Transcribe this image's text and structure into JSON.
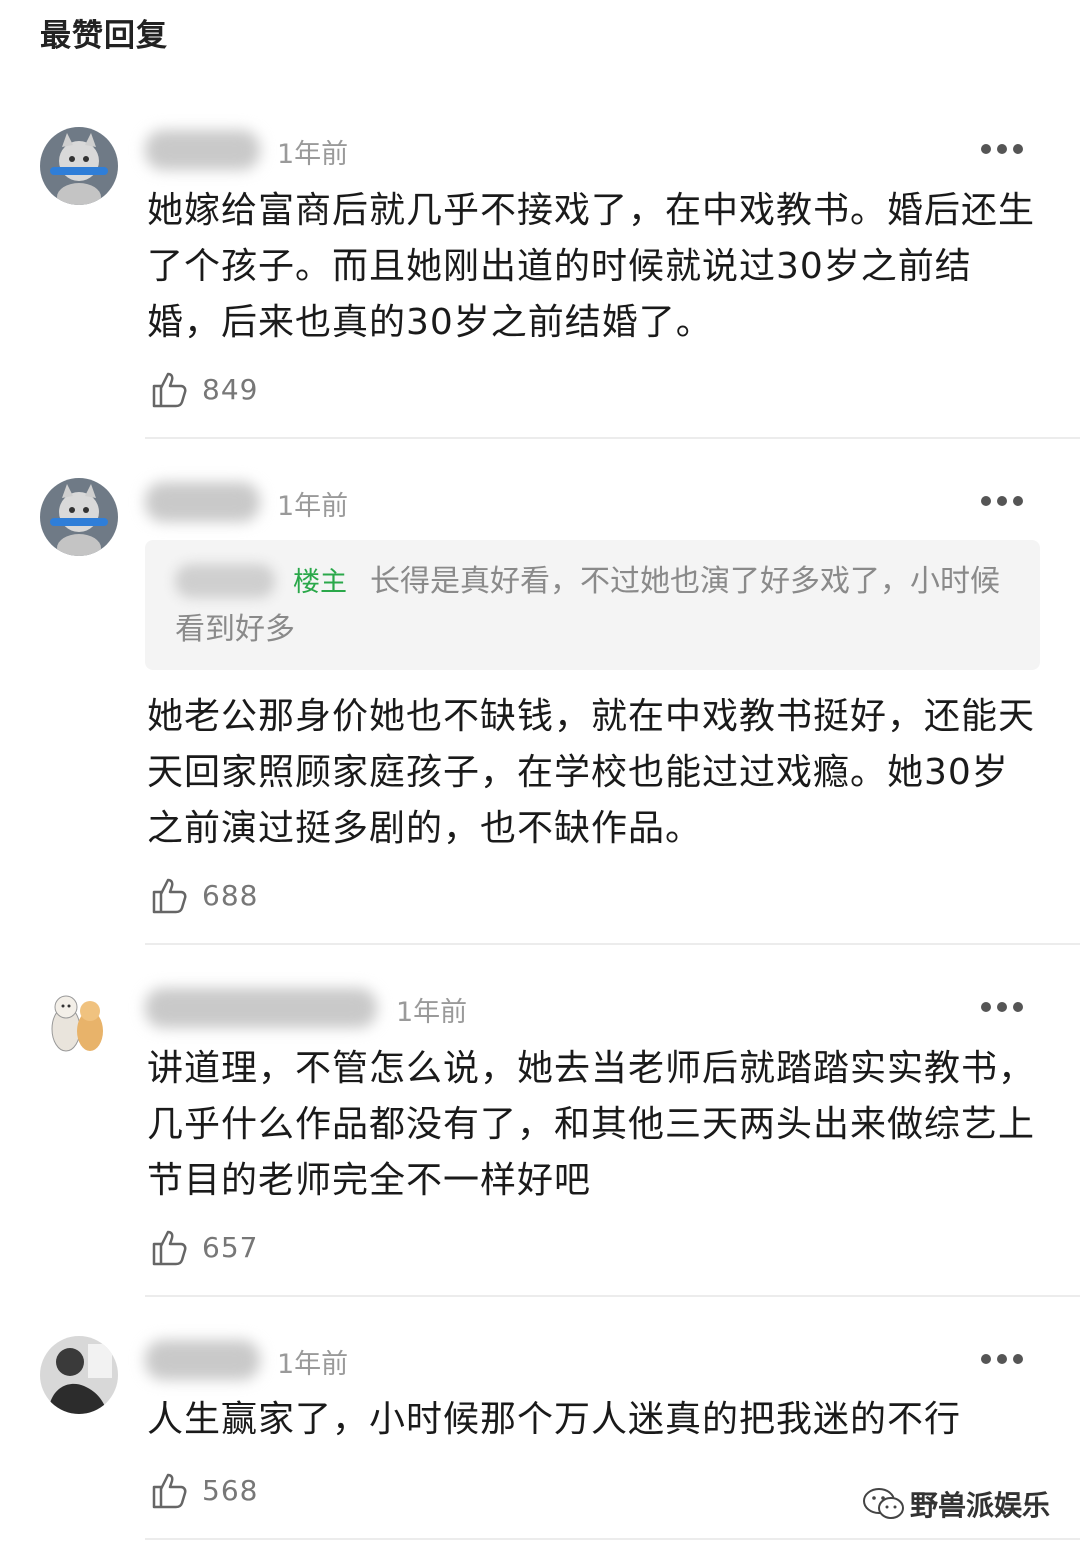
{
  "header": {
    "title": "最赞回复"
  },
  "comments": [
    {
      "time": "1年前",
      "text": "她嫁给富商后就几乎不接戏了，在中戏教书。婚后还生了个孩子。而且她刚出道的时候就说过30岁之前结婚，后来也真的30岁之前结婚了。",
      "likes": "849"
    },
    {
      "time": "1年前",
      "quote": {
        "badge": "楼主",
        "text": "长得是真好看，不过她也演了好多戏了，小时候看到好多"
      },
      "text": "她老公那身价她也不缺钱，就在中戏教书挺好，还能天天回家照顾家庭孩子，在学校也能过过戏瘾。她30岁之前演过挺多剧的，也不缺作品。",
      "likes": "688"
    },
    {
      "time": "1年前",
      "text": "讲道理，不管怎么说，她去当老师后就踏踏实实教书，几乎什么作品都没有了，和其他三天两头出来做综艺上节目的老师完全不一样好吧",
      "likes": "657"
    },
    {
      "time": "1年前",
      "text": "人生赢家了，小时候那个万人迷真的把我迷的不行",
      "likes": "568"
    }
  ],
  "watermark": {
    "text": "野兽派娱乐"
  },
  "colors": {
    "badge": "#2aa84a",
    "meta": "#9a9a9a",
    "divider": "#ececec"
  }
}
